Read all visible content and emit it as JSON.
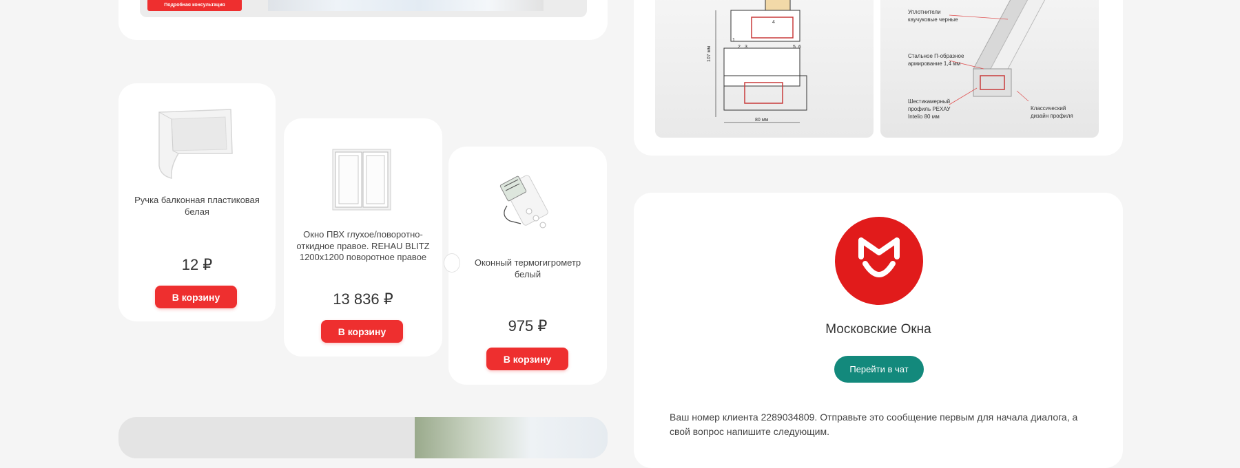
{
  "promo": {
    "consult_button": "Подробная консультация"
  },
  "nav": {
    "arrow_icon": "chevron-left-right-icon"
  },
  "products": [
    {
      "name": "Ручка балконная пластиковая белая",
      "price": "12 ₽",
      "cart_label": "В корзину",
      "image_icon": "balcony-handle-image"
    },
    {
      "name": "Окно ПВХ глухое/поворотно-откидное правое. REHAU BLITZ 1200x1200 поворотное правое",
      "price": "13 836 ₽",
      "cart_label": "В корзину",
      "image_icon": "window-image"
    },
    {
      "name": "Оконный термогигрометр белый",
      "price": "975 ₽",
      "cart_label": "В корзину",
      "image_icon": "thermohygrometer-image"
    }
  ],
  "diagram": {
    "profile_labels": [
      "107 мм",
      "80 мм",
      "1",
      "2",
      "3",
      "4",
      "5",
      "6"
    ],
    "callouts": [
      [
        "Уплотнители",
        "каучуковые черные"
      ],
      [
        "Стальное П-образное",
        "армирование 1,4 мм"
      ],
      [
        "Шестикамерный",
        "профиль РЕХАУ",
        "Intelio 80 мм"
      ],
      [
        "Классический",
        "дизайн профиля"
      ]
    ]
  },
  "chat": {
    "logo_icon": "mts-logo-icon",
    "company_name": "Московские Окна",
    "chat_button": "Перейти в чат",
    "message": "Ваш номер клиента 2289034809. Отправьте это сообщение первым для начала диалога, а свой вопрос напишите следующим."
  },
  "colors": {
    "accent_red": "#ee2f2f",
    "teal": "#13897c",
    "background": "#f5f5f5"
  }
}
